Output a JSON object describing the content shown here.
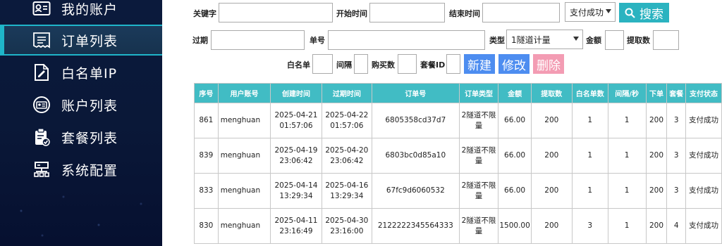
{
  "sidebar": {
    "items": [
      {
        "label": "我的账户",
        "icon": "id-card-icon"
      },
      {
        "label": "订单列表",
        "icon": "receipt-icon"
      },
      {
        "label": "白名单IP",
        "icon": "document-edit-icon"
      },
      {
        "label": "账户列表",
        "icon": "user-circle-icon"
      },
      {
        "label": "套餐列表",
        "icon": "clipboard-check-icon"
      },
      {
        "label": "系统配置",
        "icon": "server-icon"
      }
    ],
    "active_index": 1
  },
  "filters": {
    "keyword_label": "关键字",
    "start_time_label": "开始时间",
    "end_time_label": "结束时间",
    "payment_status_value": "支付成功",
    "search_label": "搜索",
    "expire_label": "过期",
    "order_no_label": "单号",
    "type_label": "类型",
    "type_value": "1隧道计量",
    "amount_label": "金额",
    "fetch_count_label": "提取数",
    "whitelist_label": "白名单",
    "interval_label": "间隔",
    "purchase_count_label": "购买数",
    "package_id_label": "套餐ID",
    "new_label": "新建",
    "edit_label": "修改",
    "delete_label": "删除"
  },
  "table": {
    "headers": [
      "序号",
      "用户账号",
      "创建时间",
      "过期时间",
      "订单号",
      "订单类型",
      "金额",
      "提取数",
      "白名单数",
      "间隔/秒",
      "下单",
      "套餐",
      "支付状态"
    ],
    "rows": [
      {
        "id": "861",
        "account": "menghuan",
        "created_date": "2025-04-21",
        "created_time": "01:57:06",
        "expire_date": "2025-04-22",
        "expire_time": "01:57:06",
        "order_no": "6805358cd37d7",
        "type_line1": "2隧道不限",
        "type_line2": "量",
        "amount": "66.00",
        "fetch": "200",
        "whitelist": "1",
        "interval": "1",
        "orders": "200",
        "package": "3",
        "status": "支付成功"
      },
      {
        "id": "839",
        "account": "menghuan",
        "created_date": "2025-04-19",
        "created_time": "23:06:42",
        "expire_date": "2025-04-20",
        "expire_time": "23:06:42",
        "order_no": "6803bc0d85a10",
        "type_line1": "2隧道不限",
        "type_line2": "量",
        "amount": "66.00",
        "fetch": "200",
        "whitelist": "1",
        "interval": "1",
        "orders": "200",
        "package": "3",
        "status": "支付成功"
      },
      {
        "id": "833",
        "account": "menghuan",
        "created_date": "2025-04-14",
        "created_time": "13:29:34",
        "expire_date": "2025-04-16",
        "expire_time": "13:29:34",
        "order_no": "67fc9d6060532",
        "type_line1": "2隧道不限",
        "type_line2": "量",
        "amount": "66.00",
        "fetch": "200",
        "whitelist": "1",
        "interval": "1",
        "orders": "200",
        "package": "3",
        "status": "支付成功"
      },
      {
        "id": "830",
        "account": "menghuan",
        "created_date": "2025-04-11",
        "created_time": "23:16:49",
        "expire_date": "2025-04-30",
        "expire_time": "23:16:00",
        "order_no": "2122222345564333",
        "type_line1": "2隧道不限",
        "type_line2": "量",
        "amount": "1500.00",
        "fetch": "200",
        "whitelist": "3",
        "interval": "1",
        "orders": "200",
        "package": "4",
        "status": "支付成功"
      }
    ]
  },
  "colors": {
    "accent": "#41bcc4",
    "sidebar_bg": "#0b1a3c",
    "new_button": "#4d8df0",
    "delete_button": "#f39cb3"
  }
}
